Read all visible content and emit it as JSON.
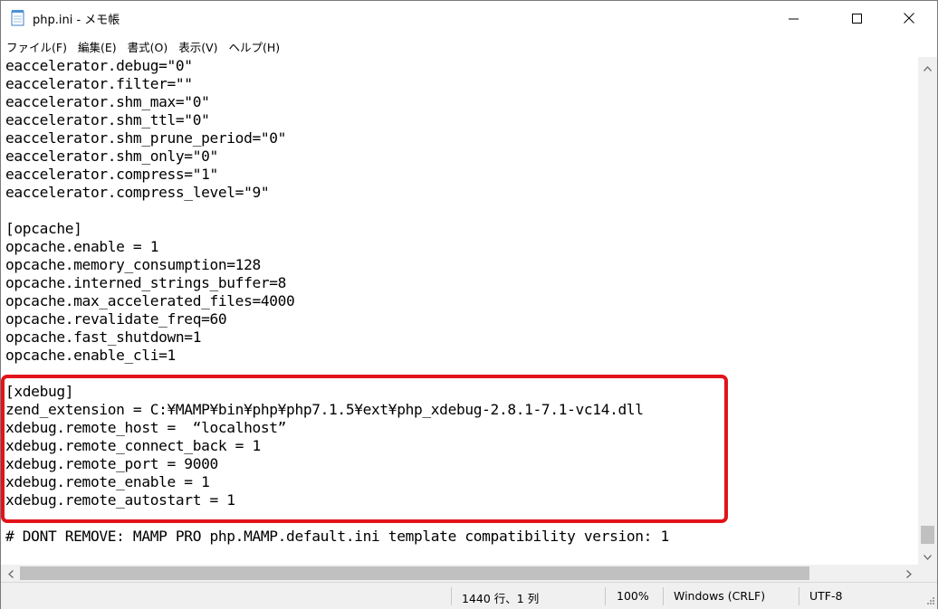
{
  "window": {
    "title": "php.ini - メモ帳",
    "minimize_glyph": "—",
    "maximize_glyph": "☐",
    "close_glyph": "✕"
  },
  "menu": {
    "items": [
      {
        "label": "ファイル(F)"
      },
      {
        "label": "編集(E)"
      },
      {
        "label": "書式(O)"
      },
      {
        "label": "表示(V)"
      },
      {
        "label": "ヘルプ(H)"
      }
    ]
  },
  "editor": {
    "lines": [
      "eaccelerator.debug=\"0\"",
      "eaccelerator.filter=\"\"",
      "eaccelerator.shm_max=\"0\"",
      "eaccelerator.shm_ttl=\"0\"",
      "eaccelerator.shm_prune_period=\"0\"",
      "eaccelerator.shm_only=\"0\"",
      "eaccelerator.compress=\"1\"",
      "eaccelerator.compress_level=\"9\"",
      "",
      "[opcache]",
      "opcache.enable = 1",
      "opcache.memory_consumption=128",
      "opcache.interned_strings_buffer=8",
      "opcache.max_accelerated_files=4000",
      "opcache.revalidate_freq=60",
      "opcache.fast_shutdown=1",
      "opcache.enable_cli=1",
      "",
      "[xdebug]",
      "zend_extension = C:¥MAMP¥bin¥php¥php7.1.5¥ext¥php_xdebug-2.8.1-7.1-vc14.dll",
      "xdebug.remote_host =  “localhost”",
      "xdebug.remote_connect_back = 1",
      "xdebug.remote_port = 9000",
      "xdebug.remote_enable = 1",
      "xdebug.remote_autostart = 1",
      "",
      "# DONT REMOVE: MAMP PRO php.MAMP.default.ini template compatibility version: 1"
    ],
    "highlight_color": "#e3131b"
  },
  "status": {
    "position": "1440 行、1 列",
    "zoom": "100%",
    "line_ending": "Windows (CRLF)",
    "encoding": "UTF-8"
  },
  "icons": {
    "app": "notepad-icon",
    "minimize": "minimize-icon",
    "maximize": "maximize-icon",
    "close": "close-icon"
  }
}
